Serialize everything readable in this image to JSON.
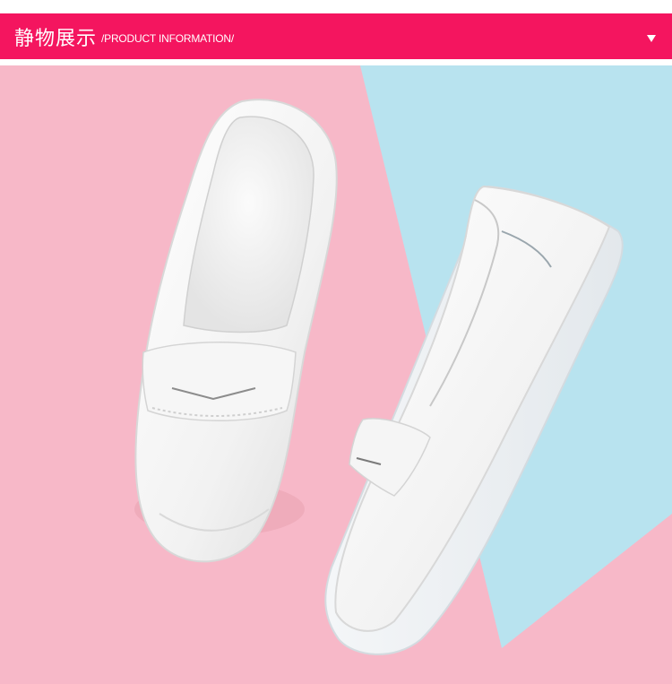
{
  "header": {
    "title_cn": "静物展示",
    "title_en": "/PRODUCT INFORMATION/",
    "bar_color": "#f4155f",
    "toggle_icon": "triangle-down-icon"
  },
  "photo": {
    "subject": "white-leather-loafers",
    "background_colors": [
      "#f7b8c8",
      "#b8e3ef"
    ]
  }
}
